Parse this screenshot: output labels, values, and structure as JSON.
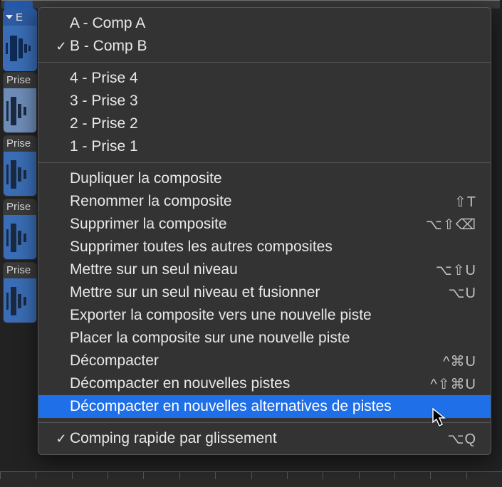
{
  "regions": {
    "main": {
      "label": "E"
    },
    "takes": [
      {
        "label": "Prise"
      },
      {
        "label": "Prise"
      },
      {
        "label": "Prise"
      },
      {
        "label": "Prise"
      }
    ]
  },
  "menu": {
    "comps": [
      {
        "label": "A - Comp A",
        "checked": false
      },
      {
        "label": "B - Comp B",
        "checked": true
      }
    ],
    "takes": [
      {
        "label": "4 - Prise 4"
      },
      {
        "label": "3 - Prise 3"
      },
      {
        "label": "2 - Prise 2"
      },
      {
        "label": "1 - Prise 1"
      }
    ],
    "actions": [
      {
        "label": "Dupliquer la composite",
        "shortcut": ""
      },
      {
        "label": "Renommer la composite",
        "shortcut": "⇧T"
      },
      {
        "label": "Supprimer la composite",
        "shortcut": "⌥⇧⌫"
      },
      {
        "label": "Supprimer toutes les autres composites",
        "shortcut": ""
      },
      {
        "label": "Mettre sur un seul niveau",
        "shortcut": "⌥⇧U"
      },
      {
        "label": "Mettre sur un seul niveau et fusionner",
        "shortcut": "⌥U"
      },
      {
        "label": "Exporter la composite vers une nouvelle piste",
        "shortcut": ""
      },
      {
        "label": "Placer la composite sur une nouvelle piste",
        "shortcut": ""
      },
      {
        "label": "Décompacter",
        "shortcut": "^⌘U"
      },
      {
        "label": "Décompacter en nouvelles pistes",
        "shortcut": "^⇧⌘U"
      },
      {
        "label": "Décompacter en nouvelles alternatives de pistes",
        "shortcut": "",
        "highlighted": true
      }
    ],
    "footer": [
      {
        "label": "Comping rapide par glissement",
        "shortcut": "⌥Q",
        "checked": true
      }
    ]
  }
}
